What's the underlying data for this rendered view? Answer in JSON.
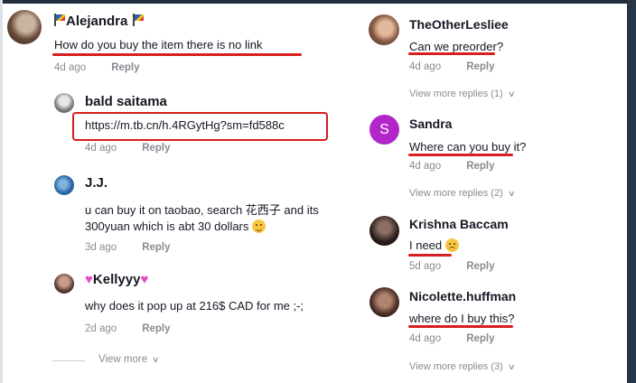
{
  "common": {
    "reply_label": "Reply"
  },
  "left": {
    "c1": {
      "name": "Alejandra",
      "text": "How do you buy the item there is no link",
      "time": "4d ago"
    },
    "c2": {
      "name": "bald saitama",
      "text": "https://m.tb.cn/h.4RGytHg?sm=fd588c",
      "time": "4d ago"
    },
    "c3": {
      "name": "J.J.",
      "text_line1": "u can buy it on taobao, search 花西子 and its",
      "text_line2": "300yuan which is abt 30 dollars",
      "time": "3d ago"
    },
    "c4": {
      "name": "Kellyyy",
      "text": "why does it pop up at 216$ CAD for me ;-;",
      "time": "2d ago"
    },
    "view_more": "View more"
  },
  "right": {
    "c1": {
      "name": "TheOtherLesliee",
      "text": "Can we preorder?",
      "time": "4d ago",
      "more": "View more replies (1)"
    },
    "c2": {
      "name": "Sandra",
      "initial": "S",
      "text": "Where can you buy it?",
      "time": "4d ago",
      "more": "View more replies (2)"
    },
    "c3": {
      "name": "Krishna Baccam",
      "text": "I need",
      "time": "5d ago"
    },
    "c4": {
      "name": "Nicolette.huffman",
      "text": "where do I buy this?",
      "time": "4d ago",
      "more": "View more replies (3)"
    }
  },
  "colors": {
    "annotation_red": "#d81e1e",
    "sandra_avatar": "#b026c9",
    "muted_text": "#8a8b91"
  },
  "icons": [
    "flag-emoji-icon",
    "heart-emoji-icon",
    "smile-emoji-icon",
    "weary-emoji-icon",
    "chevron-down-icon"
  ]
}
